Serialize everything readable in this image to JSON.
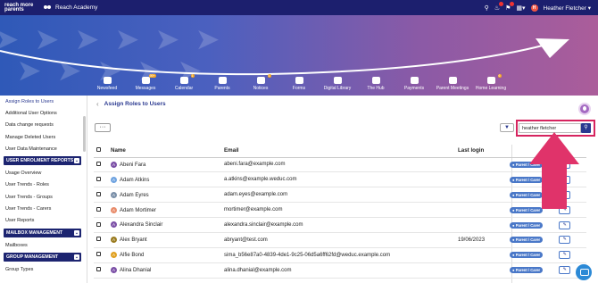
{
  "topbar": {
    "logo": "reach more parents",
    "school": "Reach Academy",
    "user_initial": "H",
    "user_name": "Heather Fletcher"
  },
  "nav": [
    {
      "label": "Newsfeed",
      "badge": ""
    },
    {
      "label": "Messages",
      "badge": "99+"
    },
    {
      "label": "Calendar",
      "badge": "1"
    },
    {
      "label": "Parents",
      "badge": ""
    },
    {
      "label": "Notices",
      "badge": "1"
    },
    {
      "label": "Forms",
      "badge": ""
    },
    {
      "label": "Digital Library",
      "badge": ""
    },
    {
      "label": "The Hub",
      "badge": ""
    },
    {
      "label": "Payments",
      "badge": ""
    },
    {
      "label": "Parent Meetings",
      "badge": ""
    },
    {
      "label": "Home Learning",
      "badge": "6"
    }
  ],
  "sidebar": {
    "items_top": [
      "Assign Roles to Users",
      "Additional User Options",
      "Data change requests",
      "Manage Deleted Users",
      "User Data Maintenance"
    ],
    "enrolment": {
      "title": "USER ENROLMENT REPORTS",
      "items": [
        "Usage Overview",
        "User Trends - Roles",
        "User Trends - Groups",
        "User Trends - Carers",
        "User Reports"
      ]
    },
    "mailbox": {
      "title": "MAILBOX MANAGEMENT",
      "items": [
        "Mailboxes"
      ]
    },
    "group": {
      "title": "GROUP MANAGEMENT",
      "items": [
        "Group Types"
      ]
    }
  },
  "main": {
    "breadcrumb": "Assign Roles to Users",
    "more": "···",
    "search": {
      "value": "heather fletcher"
    },
    "columns": {
      "name": "Name",
      "email": "Email",
      "last_login": "Last login"
    },
    "rows": [
      {
        "initial": "A",
        "name": "Abeni Fara",
        "email": "abeni.fara@example.com",
        "last_login": "",
        "role": "Parent / Carer"
      },
      {
        "initial": "A",
        "name": "Adam Atkins",
        "email": "a.atkins@example.weduc.com",
        "last_login": "",
        "role": "Parent / Carer"
      },
      {
        "initial": "A",
        "name": "Adam Eyres",
        "email": "adam.eyes@example.com",
        "last_login": "",
        "role": "Parent / Carer"
      },
      {
        "initial": "A",
        "name": "Adam Mortimer",
        "email": "mortimer@example.com",
        "last_login": "",
        "role": "Parent / Carer"
      },
      {
        "initial": "A",
        "name": "Alexandra Sinclair",
        "email": "alexandra.sinclair@example.com",
        "last_login": "",
        "role": "Parent / Carer"
      },
      {
        "initial": "A",
        "name": "Alex Bryant",
        "email": "abryant@test.com",
        "last_login": "19/06/2023",
        "role": "Parent / Carer"
      },
      {
        "initial": "A",
        "name": "Alfie Bond",
        "email": "sima_b56e87a0-4839-4de1-9c25-06d5a6ff62fd@weduc.example.com",
        "last_login": "",
        "role": "Parent / Carer"
      },
      {
        "initial": "A",
        "name": "Alina Dhanial",
        "email": "alina.dhanial@example.com",
        "last_login": "",
        "role": "Parent / Carer"
      }
    ]
  },
  "colors": {
    "accent": "#2a3990",
    "highlight": "#d6245f",
    "avatars": [
      "#7b4fa6",
      "#6fa3e0",
      "#7a8fa8",
      "#e88b6a",
      "#7b4fa6",
      "#9a7b1f",
      "#e0a020",
      "#7b4fa6"
    ]
  }
}
